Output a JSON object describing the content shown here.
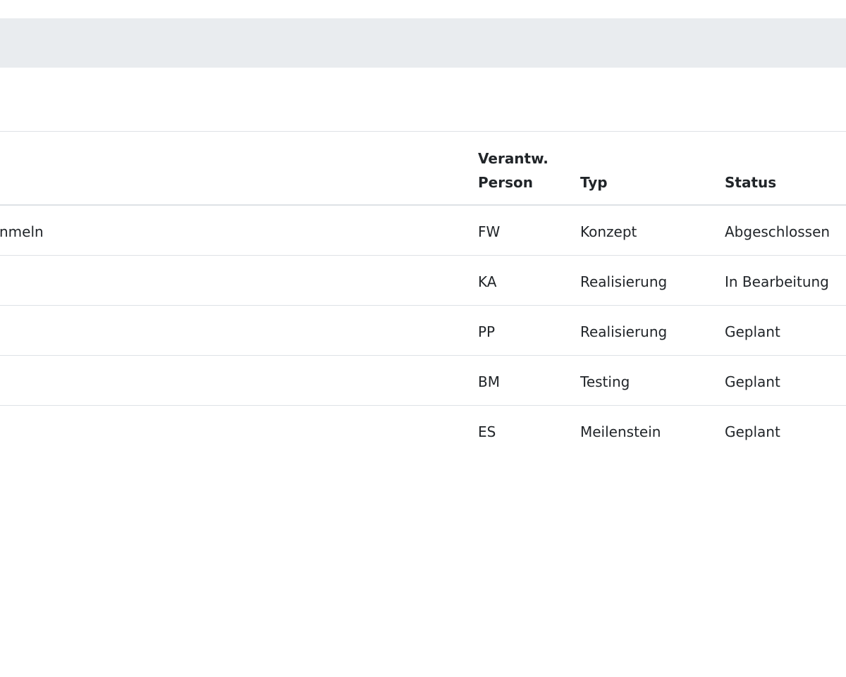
{
  "table": {
    "headers": {
      "person_line1": "Verantw.",
      "person_line2": "Person",
      "typ": "Typ",
      "status": "Status"
    },
    "rows": [
      {
        "name": "nmeln",
        "person": "FW",
        "typ": "Konzept",
        "status": "Abgeschlossen"
      },
      {
        "name": "",
        "person": "KA",
        "typ": "Realisierung",
        "status": "In Bearbeitung"
      },
      {
        "name": "",
        "person": "PP",
        "typ": "Realisierung",
        "status": "Geplant"
      },
      {
        "name": "",
        "person": "BM",
        "typ": "Testing",
        "status": "Geplant"
      },
      {
        "name": "",
        "person": "ES",
        "typ": "Meilenstein",
        "status": "Geplant"
      }
    ]
  }
}
